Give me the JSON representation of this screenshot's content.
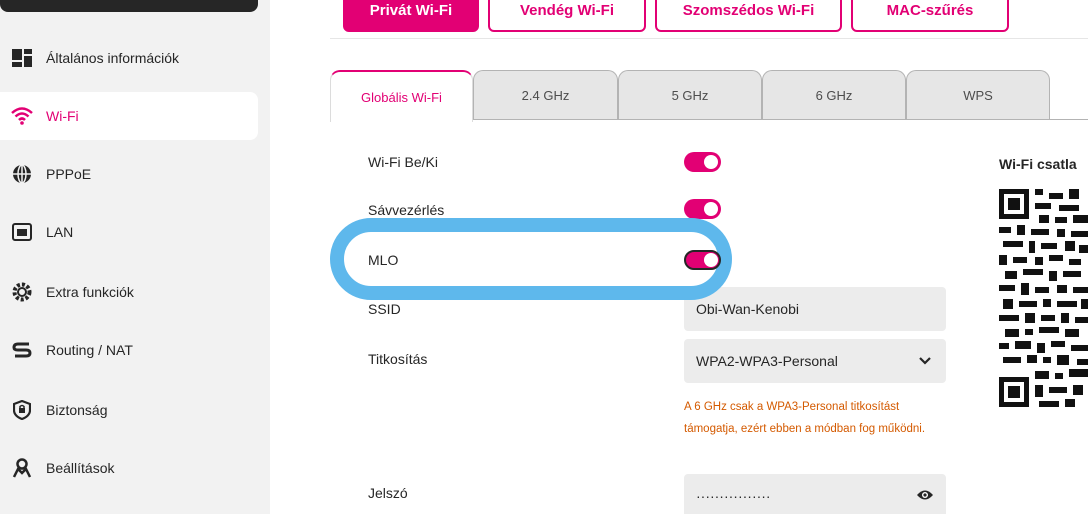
{
  "sidebar": {
    "items": [
      {
        "label": "Általános információk",
        "icon": "info-grid-icon"
      },
      {
        "label": "Wi-Fi",
        "icon": "wifi-icon",
        "active": true
      },
      {
        "label": "PPPoE",
        "icon": "globe-icon"
      },
      {
        "label": "LAN",
        "icon": "lan-port-icon"
      },
      {
        "label": "Extra funkciók",
        "icon": "gear-icon"
      },
      {
        "label": "Routing / NAT",
        "icon": "routing-icon"
      },
      {
        "label": "Biztonság",
        "icon": "shield-icon"
      },
      {
        "label": "Beállítások",
        "icon": "user-icon"
      }
    ]
  },
  "top_tabs": [
    {
      "label": "Privát Wi-Fi",
      "active": true
    },
    {
      "label": "Vendég Wi-Fi"
    },
    {
      "label": "Szomszédos Wi-Fi"
    },
    {
      "label": "MAC-szűrés"
    }
  ],
  "sub_tabs": [
    {
      "label": "Globális Wi-Fi",
      "active": true
    },
    {
      "label": "2.4 GHz"
    },
    {
      "label": "5 GHz"
    },
    {
      "label": "6 GHz"
    },
    {
      "label": "WPS"
    }
  ],
  "form": {
    "wifi_toggle": {
      "label": "Wi-Fi Be/Ki",
      "on": true
    },
    "band_steering": {
      "label": "Sávvezérlés",
      "on": true
    },
    "mlo": {
      "label": "MLO",
      "on": true
    },
    "ssid": {
      "label": "SSID",
      "value": "Obi-Wan-Kenobi"
    },
    "encryption": {
      "label": "Titkosítás",
      "value": "WPA2-WPA3-Personal",
      "hint": "A 6 GHz csak a WPA3-Personal titkosítást támogatja, ezért ebben a módban fog működni."
    },
    "password": {
      "label": "Jelszó",
      "value": "················"
    }
  },
  "qr": {
    "title": "Wi-Fi csatla"
  },
  "colors": {
    "accent": "#e20074",
    "highlight": "#5eb8ec",
    "warning": "#d45a00"
  }
}
